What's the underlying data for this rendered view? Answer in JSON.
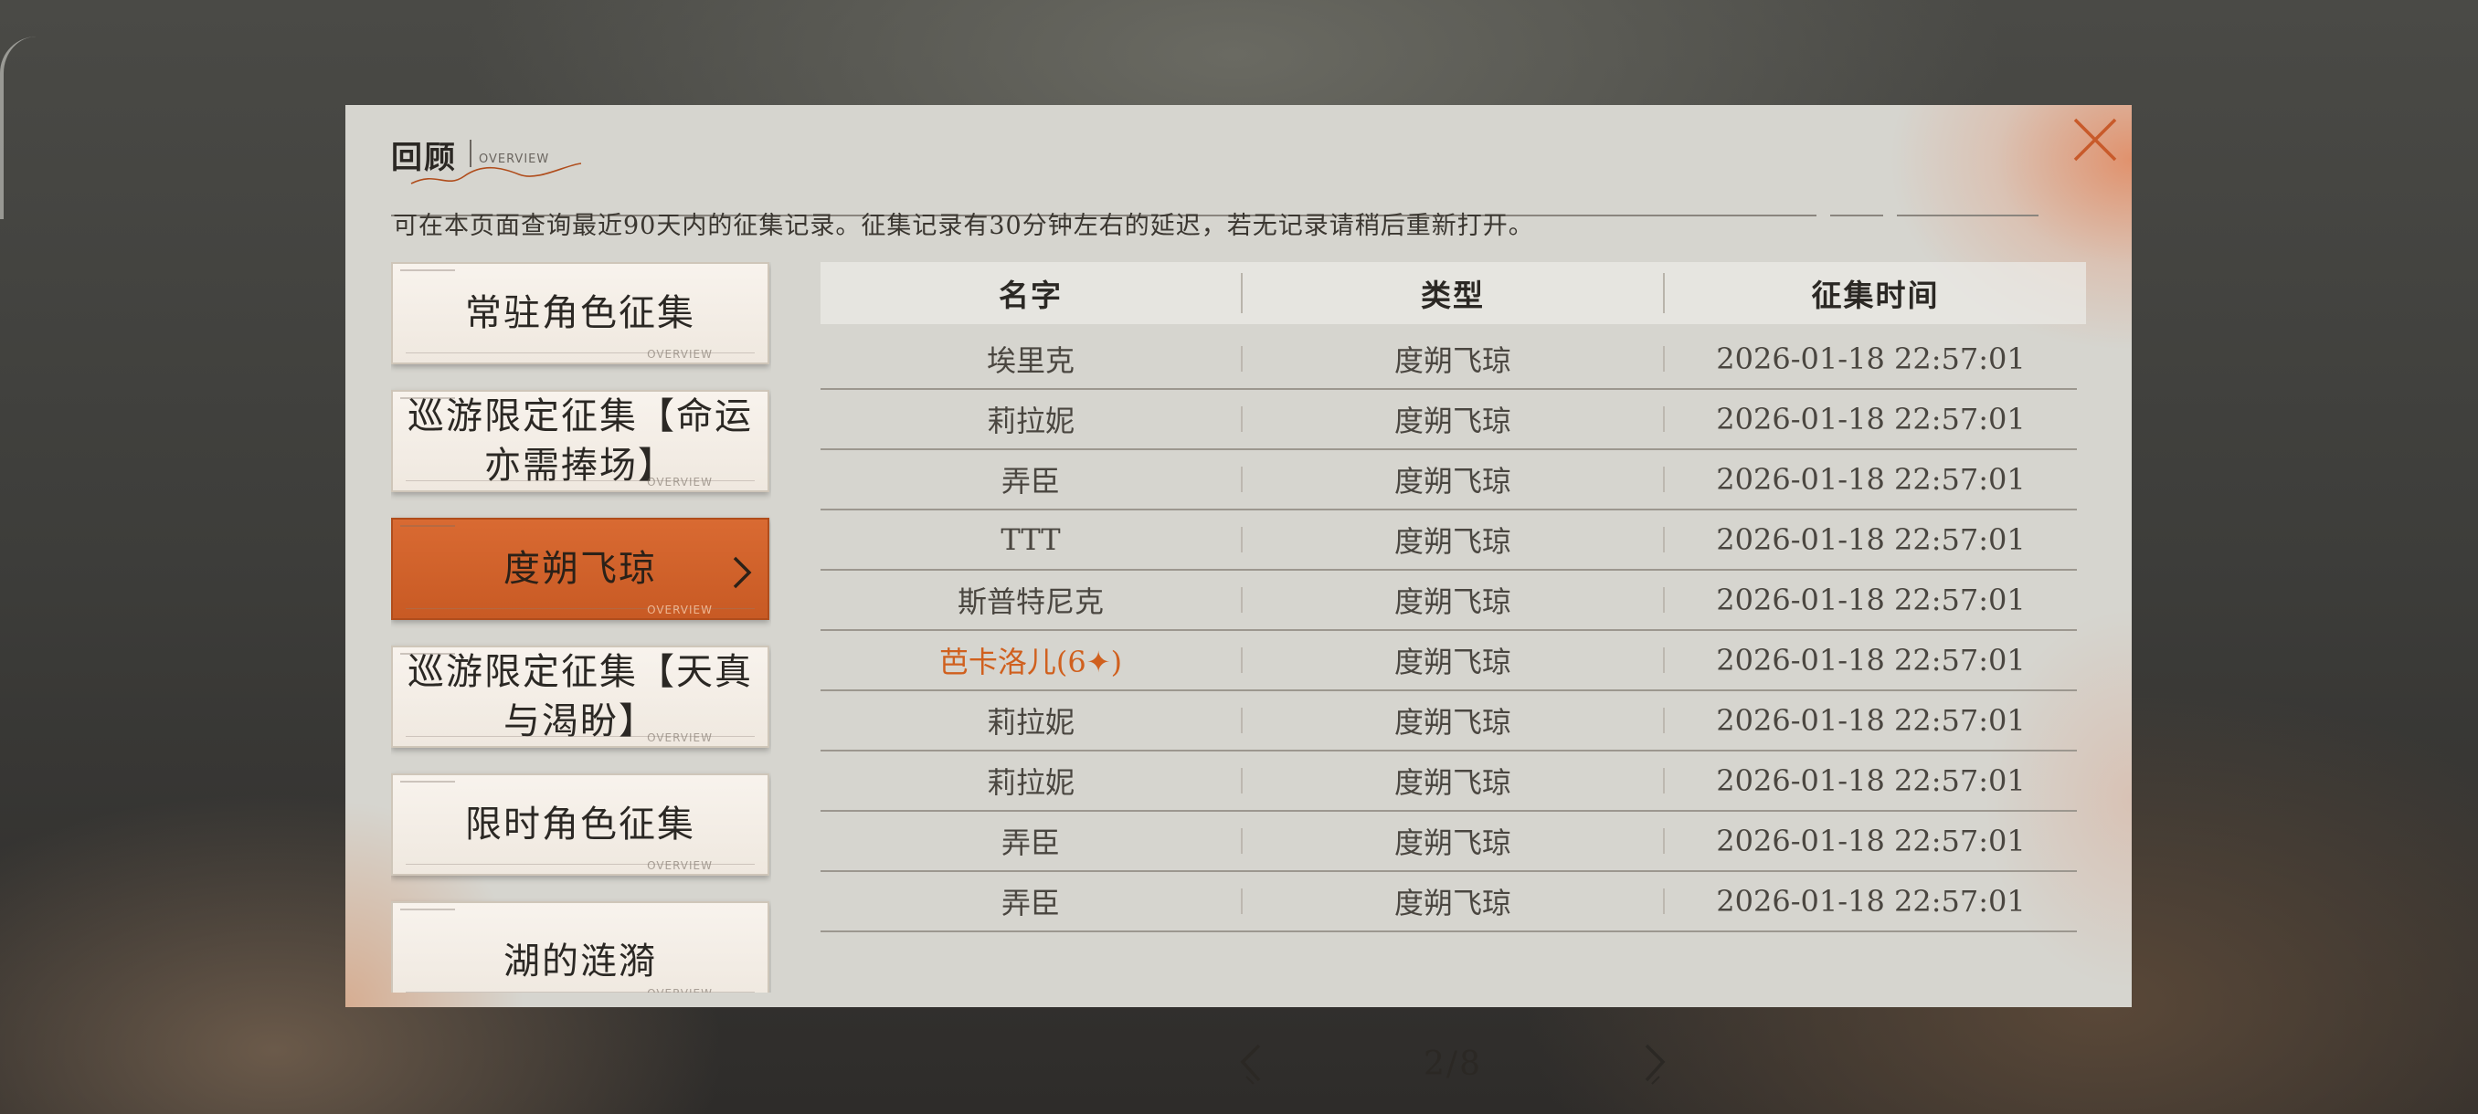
{
  "header": {
    "title": "回顾",
    "subtitle": "OVERVIEW",
    "description": "可在本页面查询最近90天内的征集记录。征集记录有30分钟左右的延迟，若无记录请稍后重新打开。"
  },
  "sidebar": {
    "items": [
      {
        "label": "常驻角色征集",
        "active": false
      },
      {
        "label": "巡游限定征集【命运亦需捧场】",
        "active": false
      },
      {
        "label": "度朔飞琼",
        "active": true
      },
      {
        "label": "巡游限定征集【天真与渴盼】",
        "active": false
      },
      {
        "label": "限时角色征集",
        "active": false
      },
      {
        "label": "湖的涟漪",
        "active": false
      }
    ],
    "deco_text": "OVERVIEW"
  },
  "table": {
    "columns": [
      "名字",
      "类型",
      "征集时间"
    ],
    "rows": [
      {
        "name": "埃里克",
        "type": "度朔飞琼",
        "time": "2026-01-18 22:57:01",
        "highlight": false
      },
      {
        "name": "莉拉妮",
        "type": "度朔飞琼",
        "time": "2026-01-18 22:57:01",
        "highlight": false
      },
      {
        "name": "弄臣",
        "type": "度朔飞琼",
        "time": "2026-01-18 22:57:01",
        "highlight": false
      },
      {
        "name": "TTT",
        "type": "度朔飞琼",
        "time": "2026-01-18 22:57:01",
        "highlight": false
      },
      {
        "name": "斯普特尼克",
        "type": "度朔飞琼",
        "time": "2026-01-18 22:57:01",
        "highlight": false
      },
      {
        "name": "芭卡洛儿(6✦)",
        "type": "度朔飞琼",
        "time": "2026-01-18 22:57:01",
        "highlight": true
      },
      {
        "name": "莉拉妮",
        "type": "度朔飞琼",
        "time": "2026-01-18 22:57:01",
        "highlight": false
      },
      {
        "name": "莉拉妮",
        "type": "度朔飞琼",
        "time": "2026-01-18 22:57:01",
        "highlight": false
      },
      {
        "name": "弄臣",
        "type": "度朔飞琼",
        "time": "2026-01-18 22:57:01",
        "highlight": false
      },
      {
        "name": "弄臣",
        "type": "度朔飞琼",
        "time": "2026-01-18 22:57:01",
        "highlight": false
      }
    ]
  },
  "pagination": {
    "label": "2/8",
    "current": 2,
    "total": 8
  },
  "colors": {
    "accent": "#d0601e",
    "active_button": "#d96a32",
    "panel": "#d6d5cf"
  },
  "icons": {
    "close": "close-x-icon",
    "prev": "chevron-left-icon",
    "next": "chevron-right-icon",
    "active_arrow": "chevron-right-icon"
  }
}
